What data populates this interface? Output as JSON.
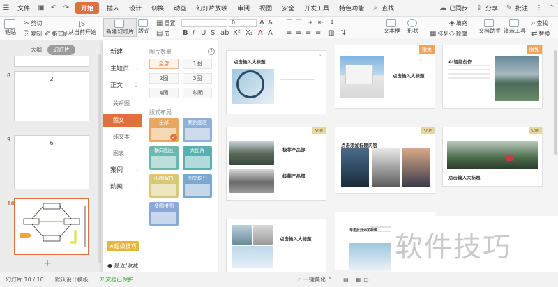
{
  "menubar": {
    "file": "文件",
    "tabs": [
      "开始",
      "插入",
      "设计",
      "切换",
      "动画",
      "幻灯片放映",
      "审阅",
      "视图",
      "安全",
      "开发工具",
      "特色功能"
    ],
    "active_tab": "开始",
    "search": "查找",
    "sync": "已同步",
    "share": "分享",
    "comment": "批注"
  },
  "ribbon": {
    "paste": "粘贴",
    "cut": "剪切",
    "copy": "复制",
    "format_painter": "格式刷",
    "play_from_current": "从当前开始",
    "new_slide": "新建幻灯片",
    "layout": "版式",
    "reset": "重置",
    "section": "节",
    "font_size": "0",
    "textbox": "文本框",
    "shape": "形状",
    "arrange": "排列",
    "fill": "填充",
    "outline": "轮廓",
    "doc_assistant": "文档助手",
    "presentation_tools": "演示工具",
    "find": "查找",
    "replace": "替换"
  },
  "leftpanel": {
    "tabs": [
      "大纲",
      "幻灯片"
    ],
    "active_tab": "幻灯片",
    "slides": [
      {
        "num": "8",
        "text": "2"
      },
      {
        "num": "9",
        "text": "6"
      },
      {
        "num": "10",
        "text": ""
      }
    ],
    "add": "+"
  },
  "dropdown": {
    "categories": [
      {
        "label": "新建",
        "sub": false
      },
      {
        "label": "主题页",
        "sub": false
      },
      {
        "label": "正文",
        "sub": false
      },
      {
        "label": "关系图",
        "sub": true
      },
      {
        "label": "图文",
        "sub": true,
        "active": true
      },
      {
        "label": "纯文本",
        "sub": true
      },
      {
        "label": "图表",
        "sub": true
      },
      {
        "label": "案例",
        "sub": false
      },
      {
        "label": "动画",
        "sub": false
      }
    ],
    "super_button": "超级技巧",
    "recent": "最近/收藏",
    "filters": {
      "image_count_title": "图片数量",
      "image_count": [
        "全部",
        "1图",
        "2图",
        "3图",
        "4图",
        "多图"
      ],
      "active_count": "全部",
      "layout_title": "版式布局",
      "layouts": [
        "全部",
        "案例图区",
        "横向图区",
        "大图片",
        "小图留白",
        "图文均分",
        "多图拼图"
      ]
    },
    "cards": [
      {
        "title": "点击输入大标题",
        "badge": ""
      },
      {
        "title": "点击输入大标题",
        "badge": "限免"
      },
      {
        "title": "AI智能创作",
        "badge": "限免"
      },
      {
        "title": "极菲产品部",
        "title2": "极菲产品部",
        "badge": "VIP"
      },
      {
        "title": "点击添加标题内容",
        "badge": "VIP"
      },
      {
        "title": "点击输入大标题",
        "badge": "VIP"
      },
      {
        "title": "点击输入大标题",
        "badge": ""
      },
      {
        "title": "单击此处添加标题",
        "badge": ""
      }
    ]
  },
  "watermark": "软件技巧",
  "statusbar": {
    "slide_count": "幻灯片 10 / 10",
    "template": "默认设计模板",
    "protected": "文档已保护",
    "beautify": "一键美化"
  },
  "colors": {
    "accent": "#e2703a",
    "badge_free": "#f2a35e",
    "badge_vip": "#e6d6a6"
  }
}
